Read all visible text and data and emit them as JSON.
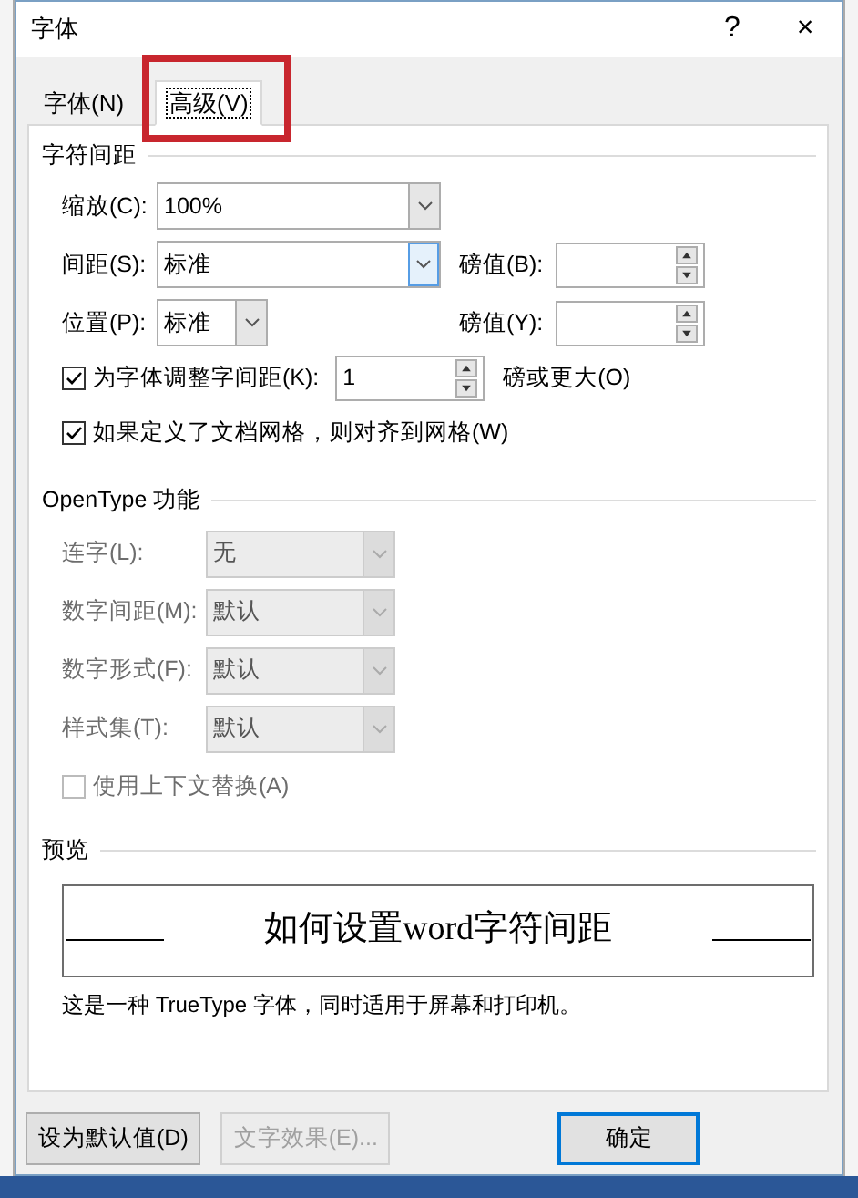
{
  "window": {
    "title": "字体",
    "help": "?",
    "close": "×"
  },
  "tabs": [
    {
      "label": "字体(N)",
      "selected": false,
      "highlighted": false
    },
    {
      "label": "高级(V)",
      "selected": true,
      "highlighted": true
    }
  ],
  "character_spacing": {
    "title": "字符间距",
    "scale": {
      "label": "缩放(C):",
      "value": "100%"
    },
    "spacing": {
      "label": "间距(S):",
      "value": "标准",
      "focused": true
    },
    "spacing_points": {
      "label": "磅值(B):"
    },
    "position": {
      "label": "位置(P):",
      "value": "标准"
    },
    "position_points": {
      "label": "磅值(Y):"
    },
    "kerning": {
      "label": "为字体调整字间距(K):",
      "checked": true,
      "value": "1",
      "suffix": "磅或更大(O)"
    },
    "snap_to_grid": {
      "label": "如果定义了文档网格，则对齐到网格(W)",
      "checked": true
    }
  },
  "opentype": {
    "title": "OpenType 功能",
    "disabled": true,
    "fields": [
      {
        "label": "连字(L):",
        "value": "无"
      },
      {
        "label": "数字间距(M):",
        "value": "默认"
      },
      {
        "label": "数字形式(F):",
        "value": "默认"
      },
      {
        "label": "样式集(T):",
        "value": "默认"
      }
    ],
    "contextual": {
      "label": "使用上下文替换(A)",
      "checked": false
    }
  },
  "preview": {
    "title": "预览",
    "sample": "如何设置word字符间距",
    "note": "这是一种 TrueType 字体，同时适用于屏幕和打印机。"
  },
  "buttons": [
    {
      "label": "设为默认值(D)",
      "disabled": false,
      "default": false
    },
    {
      "label": "文字效果(E)...",
      "disabled": true,
      "default": false
    },
    {
      "label": "确定",
      "disabled": false,
      "default": true
    }
  ]
}
